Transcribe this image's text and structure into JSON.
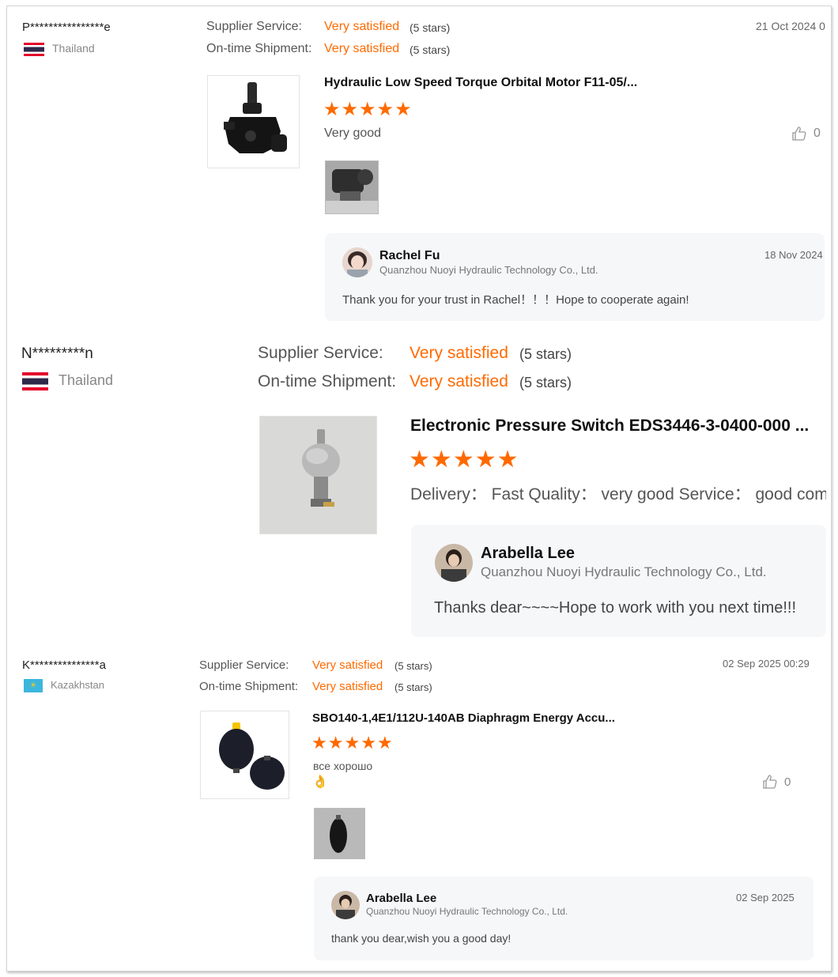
{
  "reviews": [
    {
      "buyer": "P****************e",
      "country": "Thailand",
      "supplier_service_label": "Supplier Service:",
      "supplier_service_value": "Very satisfied",
      "supplier_service_stars": "(5 stars)",
      "shipment_label": "On-time Shipment:",
      "shipment_value": "Very satisfied",
      "shipment_stars": "(5 stars)",
      "date": "21 Oct 2024 0",
      "product_title": "Hydraulic Low Speed Torque Orbital Motor F11-05/...",
      "rating_stars": 5,
      "comment": "Very good",
      "likes": "0",
      "reply": {
        "name": "Rachel Fu",
        "company": "Quanzhou Nuoyi Hydraulic Technology Co., Ltd.",
        "date": "18 Nov 2024",
        "text": "Thank you for your trust in Rachel！！！Hope to cooperate again!"
      }
    },
    {
      "buyer": "N*********n",
      "country": "Thailand",
      "supplier_service_label": "Supplier Service:",
      "supplier_service_value": "Very satisfied",
      "supplier_service_stars": "(5 stars)",
      "shipment_label": "On-time Shipment:",
      "shipment_value": "Very satisfied",
      "shipment_stars": "(5 stars)",
      "product_title": "Electronic Pressure Switch EDS3446-3-0400-000 ...",
      "rating_stars": 5,
      "comment": "Delivery： Fast Quality： very good Service： good com",
      "reply": {
        "name": "Arabella Lee",
        "company": "Quanzhou Nuoyi Hydraulic Technology Co., Ltd.",
        "text": "Thanks dear~~~~Hope to work with you next time!!!"
      }
    },
    {
      "buyer": "K***************a",
      "country": "Kazakhstan",
      "supplier_service_label": "Supplier Service:",
      "supplier_service_value": "Very satisfied",
      "supplier_service_stars": "(5 stars)",
      "shipment_label": "On-time Shipment:",
      "shipment_value": "Very satisfied",
      "shipment_stars": "(5 stars)",
      "date": "02 Sep 2025 00:29",
      "product_title": "SBO140-1,4E1/112U-140AB Diaphragm Energy Accu...",
      "rating_stars": 5,
      "comment": "все хорошо",
      "comment_emoji": "👌",
      "likes": "0",
      "reply": {
        "name": "Arabella Lee",
        "company": "Quanzhou Nuoyi Hydraulic Technology Co., Ltd.",
        "date": "02 Sep 2025",
        "text": "thank you dear,wish you a good day!"
      }
    }
  ],
  "icons": {
    "star": "★",
    "like": "thumbs-up-icon",
    "flag_thailand": "thailand-flag-icon",
    "flag_kazakhstan": "kazakhstan-flag-icon"
  },
  "colors": {
    "accent": "#ff6a00",
    "reply_bg": "#f6f7f9",
    "border": "#d6d6d6"
  }
}
